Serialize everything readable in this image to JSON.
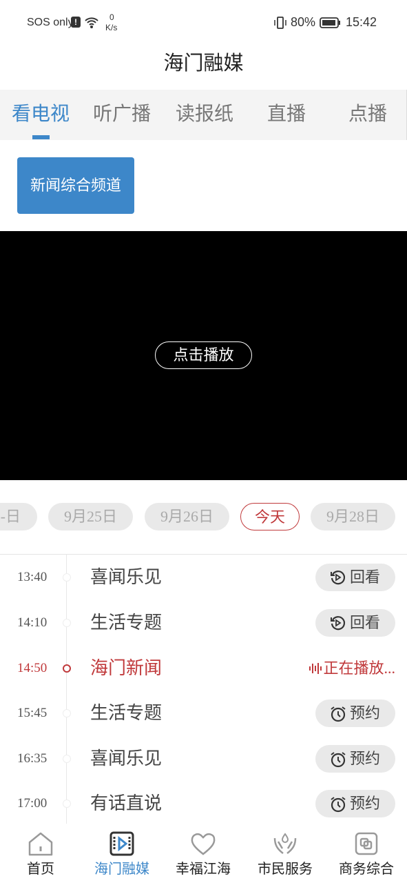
{
  "status_bar": {
    "carrier": "SOS only",
    "net_speed_value": "0",
    "net_speed_unit": "K/s",
    "battery": "80%",
    "time": "15:42"
  },
  "header": {
    "title": "海门融媒"
  },
  "tabs": [
    {
      "label": "看电视",
      "active": true
    },
    {
      "label": "听广播"
    },
    {
      "label": "读报纸"
    },
    {
      "label": "直播"
    },
    {
      "label": "点播"
    }
  ],
  "channel": {
    "label": "新闻综合频道"
  },
  "player": {
    "play_label": "点击播放"
  },
  "dates": [
    {
      "label": "-日"
    },
    {
      "label": "9月25日"
    },
    {
      "label": "9月26日"
    },
    {
      "label": "今天",
      "active": true
    },
    {
      "label": "9月28日"
    }
  ],
  "schedule": [
    {
      "time": "13:40",
      "name": "喜闻乐见",
      "action": "回看"
    },
    {
      "time": "14:10",
      "name": "生活专题",
      "action": "回看"
    },
    {
      "time": "14:50",
      "name": "海门新闻",
      "action": "正在播放..."
    },
    {
      "time": "15:45",
      "name": "生活专题",
      "action": "预约"
    },
    {
      "time": "16:35",
      "name": "喜闻乐见",
      "action": "预约"
    },
    {
      "time": "17:00",
      "name": "有话直说",
      "action": "预约"
    }
  ],
  "bottom_nav": [
    {
      "label": "首页"
    },
    {
      "label": "海门融媒",
      "active": true
    },
    {
      "label": "幸福江海"
    },
    {
      "label": "市民服务"
    },
    {
      "label": "商务综合"
    }
  ],
  "colors": {
    "accent": "#3d87c9",
    "live": "#c0393b"
  }
}
